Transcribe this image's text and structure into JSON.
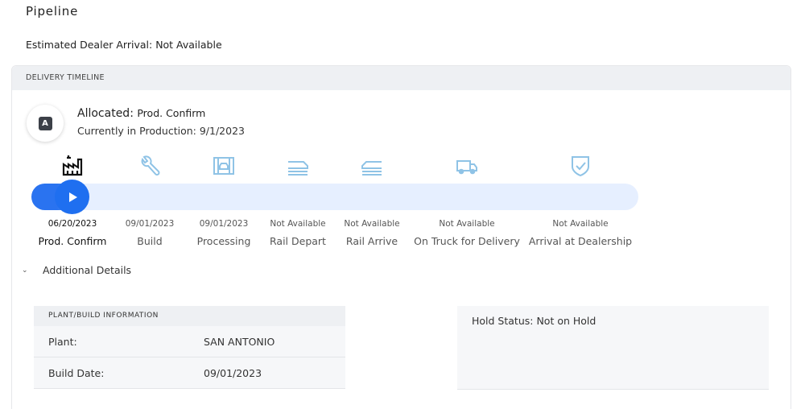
{
  "page": {
    "title": "Pipeline",
    "eta_label": "Estimated Dealer Arrival:",
    "eta_value": "Not Available"
  },
  "timeline": {
    "header": "DELIVERY TIMELINE",
    "badge_letter": "A",
    "status_title": "Allocated:",
    "status_sub": "Prod. Confirm",
    "status_line": "Currently in Production: 9/1/2023",
    "progress_percent": 3,
    "stages": [
      {
        "icon": "factory-icon",
        "date": "06/20/2023",
        "label": "Prod. Confirm",
        "active": true
      },
      {
        "icon": "wrench-icon",
        "date": "09/01/2023",
        "label": "Build",
        "active": false
      },
      {
        "icon": "assembly-icon",
        "date": "09/01/2023",
        "label": "Processing",
        "active": false
      },
      {
        "icon": "rail-depart-icon",
        "date": "Not Available",
        "label": "Rail Depart",
        "active": false
      },
      {
        "icon": "rail-arrive-icon",
        "date": "Not Available",
        "label": "Rail Arrive",
        "active": false
      },
      {
        "icon": "truck-icon",
        "date": "Not Available",
        "label": "On Truck for Delivery",
        "active": false
      },
      {
        "icon": "shield-check-icon",
        "date": "Not Available",
        "label": "Arrival at Dealership",
        "active": false
      }
    ]
  },
  "details": {
    "toggle_label": "Additional Details",
    "chevron_icon": "chevron-down-icon",
    "plant_header": "PLANT/BUILD INFORMATION",
    "plant_label": "Plant:",
    "plant_value": "SAN ANTONIO",
    "build_date_label": "Build Date:",
    "build_date_value": "09/01/2023",
    "hold_status": "Hold Status: Not on Hold"
  },
  "colors": {
    "accent": "#1f6ff0",
    "track": "#e6efff",
    "icon_inactive": "#8fc3e6",
    "icon_active": "#111111"
  }
}
